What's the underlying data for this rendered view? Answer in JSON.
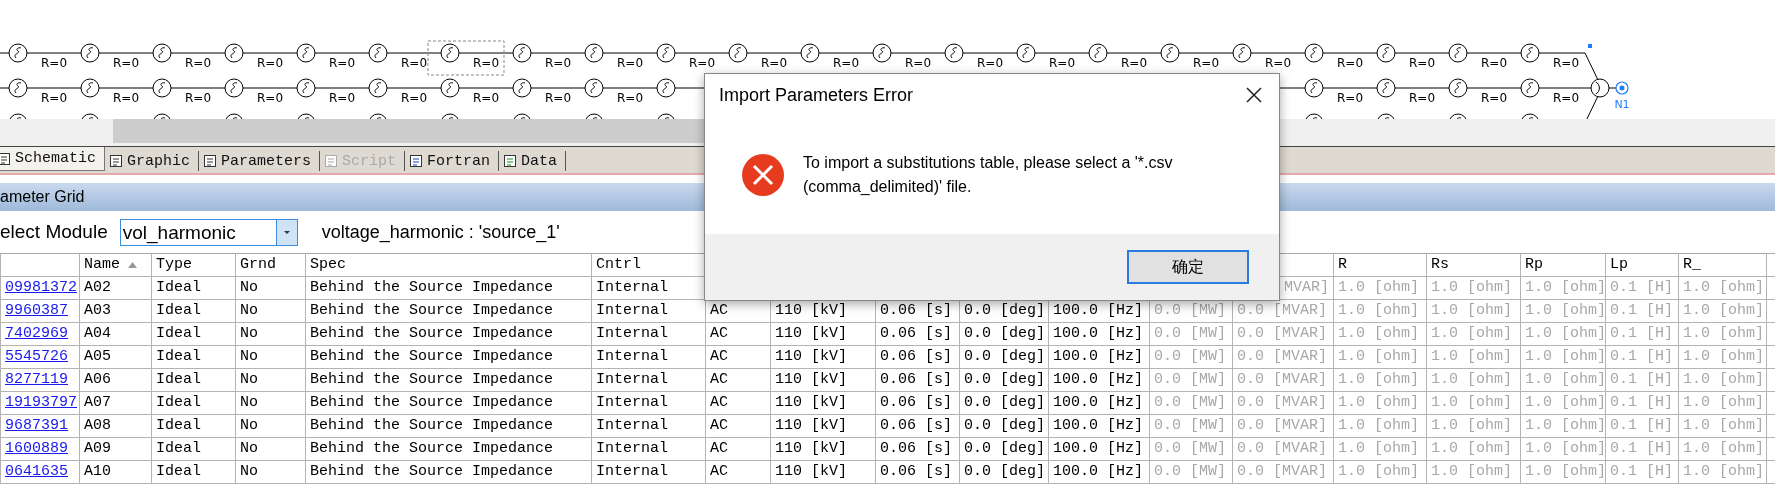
{
  "schematic": {
    "rows": [
      {
        "left_labels": [
          {
            "text": "R=0",
            "selected": false
          },
          {
            "text": "R=0",
            "selected": false
          },
          {
            "text": "R=0",
            "selected": false
          },
          {
            "text": "R=0",
            "selected": false
          },
          {
            "text": "R=0",
            "selected": false
          },
          {
            "text": "R=0",
            "selected": false
          },
          {
            "text": "R=0",
            "selected": true
          },
          {
            "text": "R=0",
            "selected": false
          },
          {
            "text": "R=0",
            "selected": false
          },
          {
            "text": "R=0",
            "selected": false
          },
          {
            "text": "R=0",
            "selected": false
          },
          {
            "text": "R=0",
            "selected": false
          },
          {
            "text": "R=0",
            "selected": false
          },
          {
            "text": "R=0",
            "selected": false
          },
          {
            "text": "R=0",
            "selected": false
          },
          {
            "text": "R=0",
            "selected": false
          },
          {
            "text": "R=0",
            "selected": false
          },
          {
            "text": "R=0",
            "selected": false
          },
          {
            "text": "R=0",
            "selected": false
          },
          {
            "text": "R=0",
            "selected": false
          },
          {
            "text": "R=0",
            "selected": false
          },
          {
            "text": "R=0",
            "selected": false
          }
        ]
      },
      {
        "left_labels": [
          {
            "text": "R=0",
            "selected": false
          },
          {
            "text": "R=0",
            "selected": false
          },
          {
            "text": "R=0",
            "selected": false
          },
          {
            "text": "R=0",
            "selected": false
          },
          {
            "text": "R=0",
            "selected": false
          },
          {
            "text": "R=0",
            "selected": false
          },
          {
            "text": "R=0",
            "selected": false
          },
          {
            "text": "R=0",
            "selected": false
          },
          {
            "text": "R=0",
            "selected": false
          }
        ],
        "right_labels": [
          {
            "text": "R=0",
            "selected": false
          },
          {
            "text": "R=0",
            "selected": false
          },
          {
            "text": "R=0",
            "selected": false
          },
          {
            "text": "R=0",
            "selected": false
          }
        ]
      }
    ],
    "node": {
      "label": "N1"
    }
  },
  "tabs": [
    {
      "label": "Schematic",
      "selected": true,
      "disabled": false
    },
    {
      "label": "Graphic",
      "selected": false,
      "disabled": false
    },
    {
      "label": "Parameters",
      "selected": false,
      "disabled": false
    },
    {
      "label": "Script",
      "selected": false,
      "disabled": true
    },
    {
      "label": "Fortran",
      "selected": false,
      "disabled": false
    },
    {
      "label": "Data",
      "selected": false,
      "disabled": false
    }
  ],
  "grid": {
    "title": "ameter Grid",
    "module_label": "elect Module",
    "module_value": "vol_harmonic",
    "module_info": "voltage_harmonic : 'source_1'"
  },
  "table": {
    "columns": [
      {
        "kind": "link",
        "sorted": false,
        "disabled": false
      },
      {
        "label": "Name",
        "kind": "text",
        "sorted": true,
        "disabled": false
      },
      {
        "label": "Type",
        "kind": "text",
        "sorted": false,
        "disabled": false
      },
      {
        "label": "Grnd",
        "kind": "text",
        "sorted": false,
        "disabled": false
      },
      {
        "label": "Spec",
        "kind": "text",
        "sorted": false,
        "disabled": false
      },
      {
        "label": "Cntrl",
        "kind": "text",
        "sorted": false,
        "disabled": false
      },
      {
        "kind": "text",
        "disabled": false
      },
      {
        "kind": "text",
        "disabled": false
      },
      {
        "kind": "text",
        "disabled": false
      },
      {
        "kind": "text",
        "disabled": false
      },
      {
        "kind": "text",
        "disabled": false
      },
      {
        "kind": "text",
        "disabled": true
      },
      {
        "kind": "text",
        "disabled": true
      },
      {
        "label": "R",
        "kind": "text",
        "sorted": false,
        "disabled": true
      },
      {
        "label": "Rs",
        "kind": "text",
        "sorted": false,
        "disabled": true
      },
      {
        "label": "Rp",
        "kind": "text",
        "sorted": false,
        "disabled": true
      },
      {
        "label": "Lp",
        "kind": "text",
        "sorted": false,
        "disabled": true
      },
      {
        "label": "R_",
        "kind": "text",
        "sorted": false,
        "disabled": true
      }
    ],
    "rows": [
      {
        "cells": [
          "09981372",
          "A02",
          "Ideal",
          "No",
          "Behind the Source Impedance",
          "Internal",
          null,
          null,
          null,
          null,
          null,
          null,
          "MVAR]",
          "1.0 [ohm]",
          "1.0 [ohm]",
          "1.0 [ohm]",
          "0.1 [H]",
          "1.0 [ohm]"
        ]
      },
      {
        "cells": [
          "9960387",
          "A03",
          "Ideal",
          "No",
          "Behind the Source Impedance",
          "Internal",
          "AC",
          "110 [kV]",
          "0.06 [s]",
          "0.0 [deg]",
          "100.0 [Hz]",
          "0.0 [MW]",
          "0.0 [MVAR]",
          "1.0 [ohm]",
          "1.0 [ohm]",
          "1.0 [ohm]",
          "0.1 [H]",
          "1.0 [ohm]"
        ]
      },
      {
        "cells": [
          "7402969",
          "A04",
          "Ideal",
          "No",
          "Behind the Source Impedance",
          "Internal",
          "AC",
          "110 [kV]",
          "0.06 [s]",
          "0.0 [deg]",
          "100.0 [Hz]",
          "0.0 [MW]",
          "0.0 [MVAR]",
          "1.0 [ohm]",
          "1.0 [ohm]",
          "1.0 [ohm]",
          "0.1 [H]",
          "1.0 [ohm]"
        ]
      },
      {
        "cells": [
          "5545726",
          "A05",
          "Ideal",
          "No",
          "Behind the Source Impedance",
          "Internal",
          "AC",
          "110 [kV]",
          "0.06 [s]",
          "0.0 [deg]",
          "100.0 [Hz]",
          "0.0 [MW]",
          "0.0 [MVAR]",
          "1.0 [ohm]",
          "1.0 [ohm]",
          "1.0 [ohm]",
          "0.1 [H]",
          "1.0 [ohm]"
        ]
      },
      {
        "cells": [
          "8277119",
          "A06",
          "Ideal",
          "No",
          "Behind the Source Impedance",
          "Internal",
          "AC",
          "110 [kV]",
          "0.06 [s]",
          "0.0 [deg]",
          "100.0 [Hz]",
          "0.0 [MW]",
          "0.0 [MVAR]",
          "1.0 [ohm]",
          "1.0 [ohm]",
          "1.0 [ohm]",
          "0.1 [H]",
          "1.0 [ohm]"
        ]
      },
      {
        "cells": [
          "19193797",
          "A07",
          "Ideal",
          "No",
          "Behind the Source Impedance",
          "Internal",
          "AC",
          "110 [kV]",
          "0.06 [s]",
          "0.0 [deg]",
          "100.0 [Hz]",
          "0.0 [MW]",
          "0.0 [MVAR]",
          "1.0 [ohm]",
          "1.0 [ohm]",
          "1.0 [ohm]",
          "0.1 [H]",
          "1.0 [ohm]"
        ]
      },
      {
        "cells": [
          "9687391",
          "A08",
          "Ideal",
          "No",
          "Behind the Source Impedance",
          "Internal",
          "AC",
          "110 [kV]",
          "0.06 [s]",
          "0.0 [deg]",
          "100.0 [Hz]",
          "0.0 [MW]",
          "0.0 [MVAR]",
          "1.0 [ohm]",
          "1.0 [ohm]",
          "1.0 [ohm]",
          "0.1 [H]",
          "1.0 [ohm]"
        ]
      },
      {
        "cells": [
          "1600889",
          "A09",
          "Ideal",
          "No",
          "Behind the Source Impedance",
          "Internal",
          "AC",
          "110 [kV]",
          "0.06 [s]",
          "0.0 [deg]",
          "100.0 [Hz]",
          "0.0 [MW]",
          "0.0 [MVAR]",
          "1.0 [ohm]",
          "1.0 [ohm]",
          "1.0 [ohm]",
          "0.1 [H]",
          "1.0 [ohm]"
        ]
      },
      {
        "cells": [
          "0641635",
          "A10",
          "Ideal",
          "No",
          "Behind the Source Impedance",
          "Internal",
          "AC",
          "110 [kV]",
          "0.06 [s]",
          "0.0 [deg]",
          "100.0 [Hz]",
          "0.0 [MW]",
          "0.0 [MVAR]",
          "1.0 [ohm]",
          "1.0 [ohm]",
          "1.0 [ohm]",
          "0.1 [H]",
          "1.0 [ohm]"
        ]
      }
    ]
  },
  "dialog": {
    "title": "Import Parameters Error",
    "message": "To import a substitutions table, please select a '*.csv (comma_delimited)' file.",
    "button": "确定"
  }
}
